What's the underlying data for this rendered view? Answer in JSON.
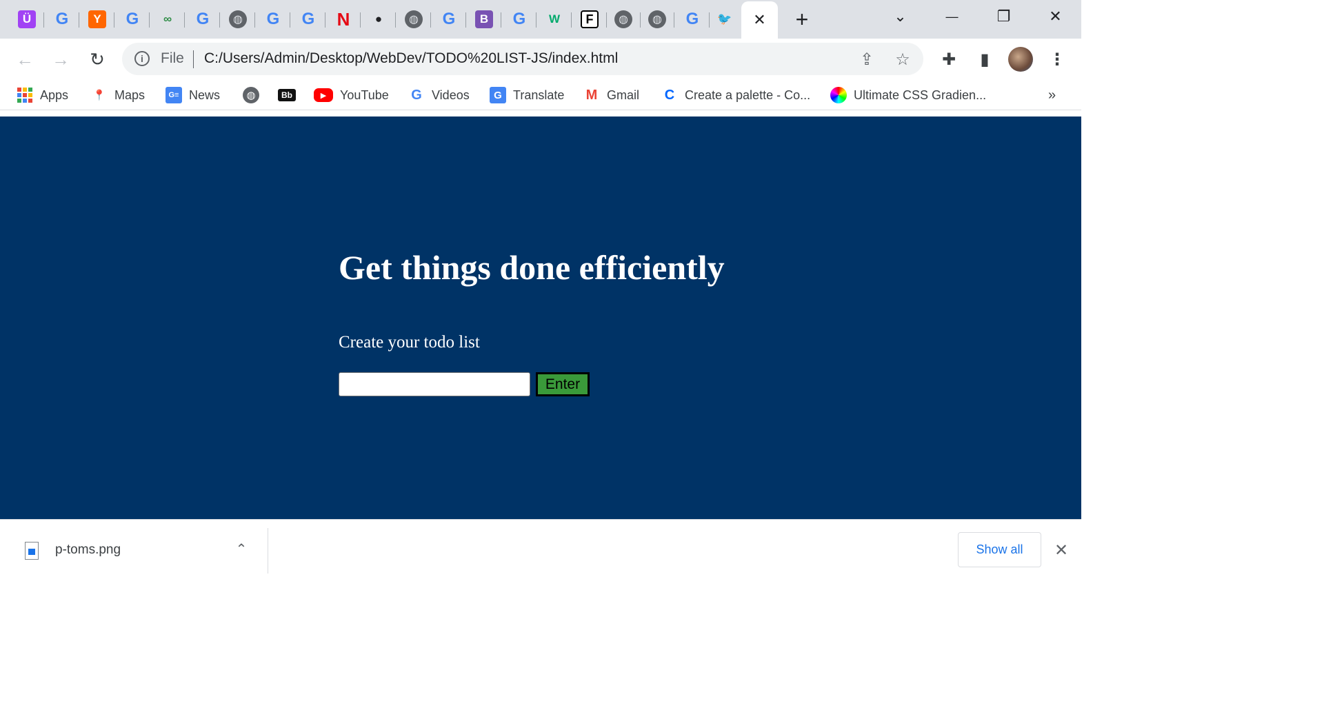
{
  "tabs": {
    "favicons": [
      {
        "name": "ublock-icon",
        "glyph": "Ü",
        "bg": "#a142f4",
        "fg": "#ffffff"
      },
      {
        "name": "google-icon",
        "glyph": "G"
      },
      {
        "name": "ycombinator-icon",
        "glyph": "Y",
        "bg": "#ff6600",
        "fg": "#ffffff"
      },
      {
        "name": "google-icon",
        "glyph": "G"
      },
      {
        "name": "geeksforgeeks-icon",
        "glyph": "∞",
        "bg": "transparent",
        "fg": "#2f8d46"
      },
      {
        "name": "google-icon",
        "glyph": "G"
      },
      {
        "name": "globe-icon",
        "glyph": "◍"
      },
      {
        "name": "google-icon",
        "glyph": "G"
      },
      {
        "name": "google-icon",
        "glyph": "G"
      },
      {
        "name": "netflix-icon",
        "glyph": "N",
        "bg": "transparent",
        "fg": "#e50914"
      },
      {
        "name": "github-icon",
        "glyph": "●",
        "bg": "transparent",
        "fg": "#202124"
      },
      {
        "name": "globe-icon",
        "glyph": "◍"
      },
      {
        "name": "google-icon",
        "glyph": "G"
      },
      {
        "name": "bootstrap-icon",
        "glyph": "B",
        "bg": "#7952b3",
        "fg": "#ffffff"
      },
      {
        "name": "google-icon",
        "glyph": "G"
      },
      {
        "name": "w3schools-icon",
        "glyph": "W",
        "bg": "transparent",
        "fg": "#04aa6d"
      },
      {
        "name": "freecodecamp-icon",
        "glyph": "F",
        "bg": "#ffffff",
        "fg": "#000000"
      },
      {
        "name": "globe-icon",
        "glyph": "◍"
      },
      {
        "name": "globe-icon",
        "glyph": "◍"
      },
      {
        "name": "google-icon",
        "glyph": "G"
      },
      {
        "name": "twitter-icon",
        "glyph": "🐦",
        "bg": "transparent",
        "fg": "#1da1f2"
      }
    ],
    "active_close": "✕",
    "new_tab": "+"
  },
  "window": {
    "dropdown": "⌄",
    "minimize": "—",
    "restore": "❐",
    "close": "✕"
  },
  "toolbar": {
    "back": "←",
    "forward": "→",
    "reload": "↻",
    "info": "i",
    "scheme": "File",
    "url": "C:/Users/Admin/Desktop/WebDev/TODO%20LIST-JS/index.html",
    "share": "⇪",
    "star": "☆",
    "extensions": "✚",
    "sidepanel": "▮",
    "menu": "⋮"
  },
  "bookmarks": [
    {
      "name": "bookmark-apps",
      "icon": "apps-grid-icon",
      "label": "Apps"
    },
    {
      "name": "bookmark-maps",
      "icon": "maps-pin-icon",
      "label": "Maps"
    },
    {
      "name": "bookmark-news",
      "icon": "google-news-icon",
      "label": "News"
    },
    {
      "name": "bookmark-globe",
      "icon": "globe-icon",
      "label": ""
    },
    {
      "name": "bookmark-blackboard",
      "icon": "blackboard-icon",
      "label": ""
    },
    {
      "name": "bookmark-youtube",
      "icon": "youtube-icon",
      "label": "YouTube"
    },
    {
      "name": "bookmark-videos",
      "icon": "google-icon",
      "label": "Videos"
    },
    {
      "name": "bookmark-translate",
      "icon": "translate-icon",
      "label": "Translate"
    },
    {
      "name": "bookmark-gmail",
      "icon": "gmail-icon",
      "label": "Gmail"
    },
    {
      "name": "bookmark-coolors",
      "icon": "coolors-icon",
      "label": "Create a palette - Co..."
    },
    {
      "name": "bookmark-cssgradient",
      "icon": "gradient-icon",
      "label": "Ultimate CSS Gradien..."
    }
  ],
  "bookmarks_overflow": "»",
  "page": {
    "title": "Get things done efficiently",
    "subtitle": "Create your todo list",
    "input_value": "",
    "enter_label": "Enter",
    "background": "#003366",
    "button_color": "#3a9a3a"
  },
  "downloads": {
    "file_name": "p-toms.png",
    "chevron": "⌃",
    "show_all": "Show all",
    "close": "✕"
  }
}
